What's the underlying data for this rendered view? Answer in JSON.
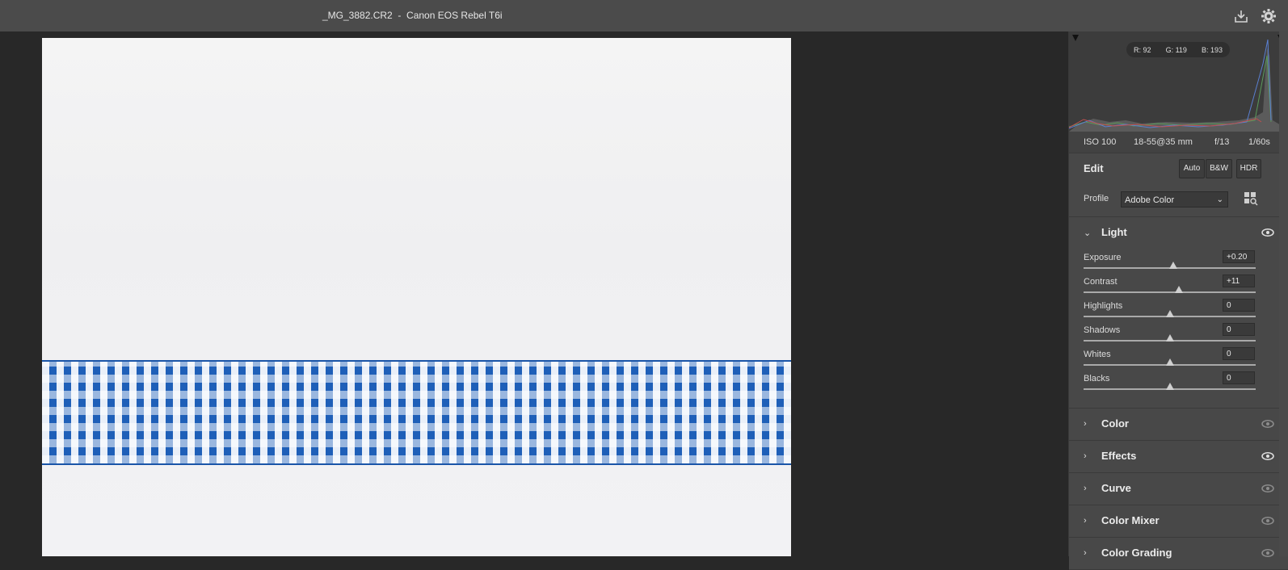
{
  "title_bar": {
    "filename": "_MG_3882.CR2  -  Canon EOS Rebel T6i",
    "save_icon": "save-to-icon",
    "settings_icon": "gear-icon"
  },
  "histogram": {
    "r": "R: 92",
    "g": "G: 119",
    "b": "B: 193"
  },
  "camera": {
    "iso": "ISO 100",
    "lens": "18-55@35 mm",
    "aperture": "f/13",
    "shutter": "1/60s"
  },
  "edit": {
    "title": "Edit",
    "buttons": [
      "Auto",
      "B&W",
      "HDR"
    ]
  },
  "profile": {
    "label": "Profile",
    "value": "Adobe Color"
  },
  "light": {
    "title": "Light",
    "sliders": [
      {
        "label": "Exposure",
        "value": "+0.20",
        "position": 0.52
      },
      {
        "label": "Contrast",
        "value": "+11",
        "position": 0.555
      },
      {
        "label": "Highlights",
        "value": "0",
        "position": 0.5
      },
      {
        "label": "Shadows",
        "value": "0",
        "position": 0.5
      },
      {
        "label": "Whites",
        "value": "0",
        "position": 0.5
      },
      {
        "label": "Blacks",
        "value": "0",
        "position": 0.5
      }
    ]
  },
  "sections": [
    {
      "title": "Color"
    },
    {
      "title": "Effects"
    },
    {
      "title": "Curve"
    },
    {
      "title": "Color Mixer"
    },
    {
      "title": "Color Grading"
    }
  ],
  "colors": {
    "ribbon_blue": "#1e5fb8",
    "panel_bg": "#535353"
  }
}
